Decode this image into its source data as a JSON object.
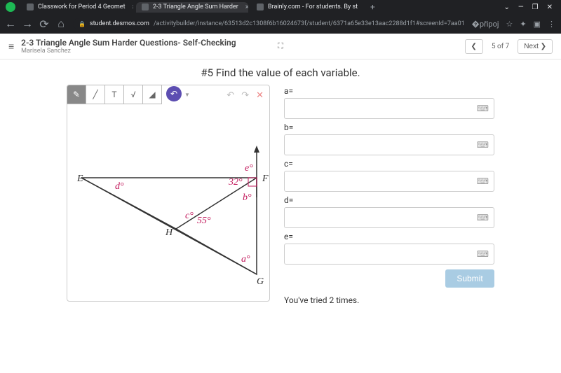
{
  "browser": {
    "tabs": [
      {
        "label": "Classwork for Period 4 Geomet"
      },
      {
        "label": "2-3 Triangle Angle Sum Harder"
      },
      {
        "label": "Brainly.com - For students. By st"
      }
    ],
    "url_domain": "student.desmos.com",
    "url_path": "/activitybuilder/instance/63513d2c1308f6b16024673f/student/6371a65e33e13aac2288d1f1#screenId=7aa01d0c-35fd-4095-b9c7-14..."
  },
  "header": {
    "title": "2-3 Triangle Angle Sum Harder Questions- Self-Checking",
    "student": "Marisela Sanchez",
    "page_counter": "5 of 7",
    "prev": "❮",
    "next": "Next ❯"
  },
  "question": {
    "title": "#5 Find the value of each variable."
  },
  "diagram": {
    "vertices": {
      "E": "E",
      "F": "F",
      "G": "G",
      "H": "H"
    },
    "angles": {
      "d": "d°",
      "e": "e°",
      "angle32": "32°",
      "b": "b°",
      "c": "c°",
      "angle55": "55°",
      "a": "a°"
    }
  },
  "answers": {
    "labels": {
      "a": "a=",
      "b": "b=",
      "c": "c=",
      "d": "d=",
      "e": "e="
    },
    "submit": "Submit"
  },
  "feedback": {
    "tries": "You've tried 2 times."
  }
}
